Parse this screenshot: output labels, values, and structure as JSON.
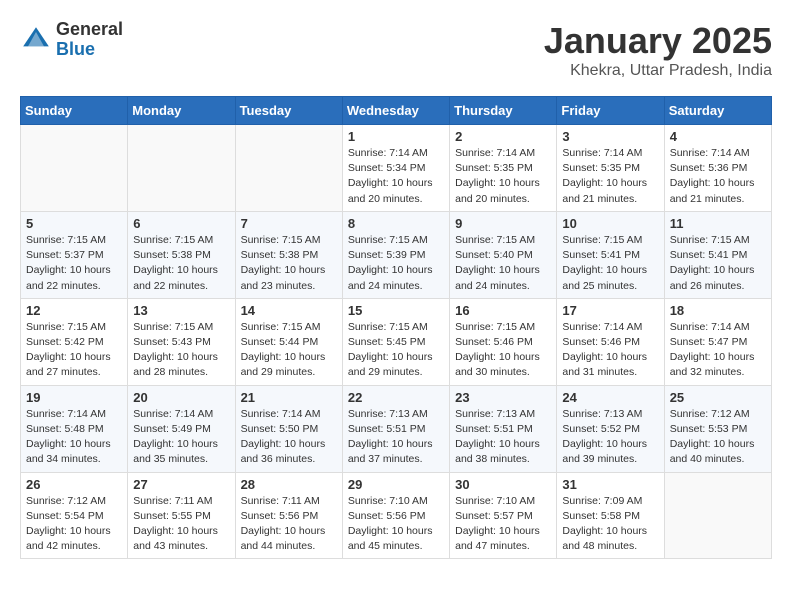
{
  "header": {
    "logo_general": "General",
    "logo_blue": "Blue",
    "month_title": "January 2025",
    "subtitle": "Khekra, Uttar Pradesh, India"
  },
  "weekdays": [
    "Sunday",
    "Monday",
    "Tuesday",
    "Wednesday",
    "Thursday",
    "Friday",
    "Saturday"
  ],
  "weeks": [
    [
      {
        "day": "",
        "info": ""
      },
      {
        "day": "",
        "info": ""
      },
      {
        "day": "",
        "info": ""
      },
      {
        "day": "1",
        "info": "Sunrise: 7:14 AM\nSunset: 5:34 PM\nDaylight: 10 hours\nand 20 minutes."
      },
      {
        "day": "2",
        "info": "Sunrise: 7:14 AM\nSunset: 5:35 PM\nDaylight: 10 hours\nand 20 minutes."
      },
      {
        "day": "3",
        "info": "Sunrise: 7:14 AM\nSunset: 5:35 PM\nDaylight: 10 hours\nand 21 minutes."
      },
      {
        "day": "4",
        "info": "Sunrise: 7:14 AM\nSunset: 5:36 PM\nDaylight: 10 hours\nand 21 minutes."
      }
    ],
    [
      {
        "day": "5",
        "info": "Sunrise: 7:15 AM\nSunset: 5:37 PM\nDaylight: 10 hours\nand 22 minutes."
      },
      {
        "day": "6",
        "info": "Sunrise: 7:15 AM\nSunset: 5:38 PM\nDaylight: 10 hours\nand 22 minutes."
      },
      {
        "day": "7",
        "info": "Sunrise: 7:15 AM\nSunset: 5:38 PM\nDaylight: 10 hours\nand 23 minutes."
      },
      {
        "day": "8",
        "info": "Sunrise: 7:15 AM\nSunset: 5:39 PM\nDaylight: 10 hours\nand 24 minutes."
      },
      {
        "day": "9",
        "info": "Sunrise: 7:15 AM\nSunset: 5:40 PM\nDaylight: 10 hours\nand 24 minutes."
      },
      {
        "day": "10",
        "info": "Sunrise: 7:15 AM\nSunset: 5:41 PM\nDaylight: 10 hours\nand 25 minutes."
      },
      {
        "day": "11",
        "info": "Sunrise: 7:15 AM\nSunset: 5:41 PM\nDaylight: 10 hours\nand 26 minutes."
      }
    ],
    [
      {
        "day": "12",
        "info": "Sunrise: 7:15 AM\nSunset: 5:42 PM\nDaylight: 10 hours\nand 27 minutes."
      },
      {
        "day": "13",
        "info": "Sunrise: 7:15 AM\nSunset: 5:43 PM\nDaylight: 10 hours\nand 28 minutes."
      },
      {
        "day": "14",
        "info": "Sunrise: 7:15 AM\nSunset: 5:44 PM\nDaylight: 10 hours\nand 29 minutes."
      },
      {
        "day": "15",
        "info": "Sunrise: 7:15 AM\nSunset: 5:45 PM\nDaylight: 10 hours\nand 29 minutes."
      },
      {
        "day": "16",
        "info": "Sunrise: 7:15 AM\nSunset: 5:46 PM\nDaylight: 10 hours\nand 30 minutes."
      },
      {
        "day": "17",
        "info": "Sunrise: 7:14 AM\nSunset: 5:46 PM\nDaylight: 10 hours\nand 31 minutes."
      },
      {
        "day": "18",
        "info": "Sunrise: 7:14 AM\nSunset: 5:47 PM\nDaylight: 10 hours\nand 32 minutes."
      }
    ],
    [
      {
        "day": "19",
        "info": "Sunrise: 7:14 AM\nSunset: 5:48 PM\nDaylight: 10 hours\nand 34 minutes."
      },
      {
        "day": "20",
        "info": "Sunrise: 7:14 AM\nSunset: 5:49 PM\nDaylight: 10 hours\nand 35 minutes."
      },
      {
        "day": "21",
        "info": "Sunrise: 7:14 AM\nSunset: 5:50 PM\nDaylight: 10 hours\nand 36 minutes."
      },
      {
        "day": "22",
        "info": "Sunrise: 7:13 AM\nSunset: 5:51 PM\nDaylight: 10 hours\nand 37 minutes."
      },
      {
        "day": "23",
        "info": "Sunrise: 7:13 AM\nSunset: 5:51 PM\nDaylight: 10 hours\nand 38 minutes."
      },
      {
        "day": "24",
        "info": "Sunrise: 7:13 AM\nSunset: 5:52 PM\nDaylight: 10 hours\nand 39 minutes."
      },
      {
        "day": "25",
        "info": "Sunrise: 7:12 AM\nSunset: 5:53 PM\nDaylight: 10 hours\nand 40 minutes."
      }
    ],
    [
      {
        "day": "26",
        "info": "Sunrise: 7:12 AM\nSunset: 5:54 PM\nDaylight: 10 hours\nand 42 minutes."
      },
      {
        "day": "27",
        "info": "Sunrise: 7:11 AM\nSunset: 5:55 PM\nDaylight: 10 hours\nand 43 minutes."
      },
      {
        "day": "28",
        "info": "Sunrise: 7:11 AM\nSunset: 5:56 PM\nDaylight: 10 hours\nand 44 minutes."
      },
      {
        "day": "29",
        "info": "Sunrise: 7:10 AM\nSunset: 5:56 PM\nDaylight: 10 hours\nand 45 minutes."
      },
      {
        "day": "30",
        "info": "Sunrise: 7:10 AM\nSunset: 5:57 PM\nDaylight: 10 hours\nand 47 minutes."
      },
      {
        "day": "31",
        "info": "Sunrise: 7:09 AM\nSunset: 5:58 PM\nDaylight: 10 hours\nand 48 minutes."
      },
      {
        "day": "",
        "info": ""
      }
    ]
  ]
}
